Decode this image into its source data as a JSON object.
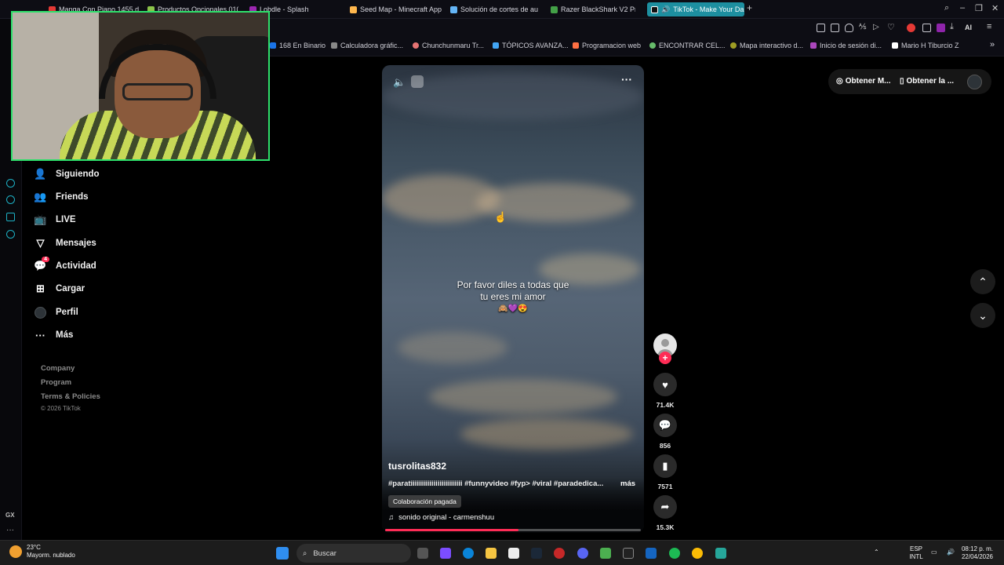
{
  "tabs": [
    {
      "label": "Manga Con Piano 1455 d...",
      "color": "#e53935"
    },
    {
      "label": "Productos Opcionales 010...",
      "color": "#8bc34a"
    },
    {
      "label": "Lobdle - Splash",
      "color": "#9c27b0"
    },
    {
      "label": "Seed Map - Minecraft App",
      "color": "#ffb74d"
    },
    {
      "label": "Solución de cortes de auc",
      "color": "#64b5f6"
    },
    {
      "label": "Razer BlackShark V2 Pro",
      "color": "#43a047"
    },
    {
      "label": "TikTok - Make Your Da",
      "color": "#000000",
      "active": true
    }
  ],
  "bookmarks": [
    {
      "label": "168 En Binario"
    },
    {
      "label": "Calculadora gráfic..."
    },
    {
      "label": "Chunchunmaru Tr..."
    },
    {
      "label": "TÓPICOS AVANZA..."
    },
    {
      "label": "Programacion web"
    },
    {
      "label": "ENCONTRAR CEL..."
    },
    {
      "label": "Mapa interactivo d..."
    },
    {
      "label": "Inicio de sesión di..."
    },
    {
      "label": "Mario H Tiburcio Z"
    }
  ],
  "toolbar": {
    "ai_label": "AI"
  },
  "nav": {
    "siguiendo": "Siguiendo",
    "friends": "Friends",
    "live": "LIVE",
    "mensajes": "Mensajes",
    "actividad": "Actividad",
    "actividad_badge": "4",
    "cargar": "Cargar",
    "perfil": "Perfil",
    "mas": "Más"
  },
  "footer": {
    "company": "Company",
    "program": "Program",
    "terms": "Terms & Policies",
    "copyright": "© 2026 TikTok"
  },
  "video": {
    "caption_line1": "Por favor diles a todas que",
    "caption_line2": "tu eres mi amor",
    "caption_emoji": "🙈💜😍",
    "username": "tusrolitas832",
    "tags": "#paratiiiiiiiiiiiiiiiiiiiiiiiii #funnyvideo #fyp> #viral #paradedica...",
    "more": "más",
    "paid_badge": "Colaboración pagada",
    "sound": "sonido original - carmenshuu",
    "progress": 0.52
  },
  "actions": {
    "likes": "71.4K",
    "comments": "856",
    "saves": "7571",
    "shares": "15.3K"
  },
  "topright": {
    "get_app": "Obtener M...",
    "get_mobile": "Obtener la ..."
  },
  "taskbar": {
    "temp": "23°C",
    "weather": "Mayorm. nublado",
    "search": "Buscar",
    "lang1": "ESP",
    "lang2": "INTL",
    "time": "08:12 p. m.",
    "date": "22/04/2026"
  }
}
